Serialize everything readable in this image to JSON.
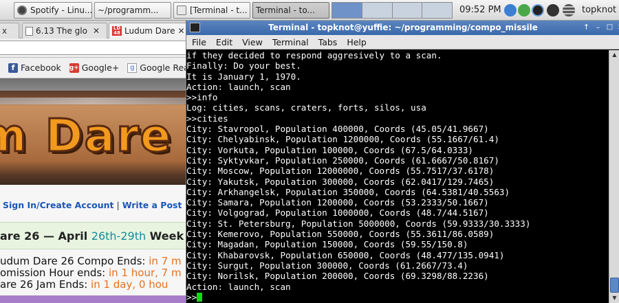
{
  "taskbar": {
    "tasks": [
      {
        "label": "Spotify - Linu...",
        "icon": "spotify-icon"
      },
      {
        "label": "~/programm...",
        "icon": "terminal-icon"
      },
      {
        "label": "[Terminal - t...",
        "icon": "terminal-icon"
      },
      {
        "label": "Terminal - to...",
        "icon": "terminal-icon"
      }
    ],
    "clock": "09:52 PM",
    "user": "topknot"
  },
  "browser": {
    "tabs": [
      {
        "label": "x"
      },
      {
        "label": "6.13 The glo"
      },
      {
        "label": "Ludum Dare"
      }
    ],
    "bookmarks": [
      "Facebook",
      "Google+",
      "Google Rea"
    ],
    "logo_text": "m Dare",
    "links": [
      "Sign In/Create Account",
      "Write a Post"
    ],
    "link_separator": "|",
    "heading": {
      "prefix": "are 26 — April ",
      "dates": "26th-29th",
      "suffix": " Week"
    },
    "deadlines": [
      {
        "label": "udum Dare 26 Compo Ends: ",
        "value": "in 7 m"
      },
      {
        "label": "omission Hour ends: ",
        "value": "in 1 hour, 7 m"
      },
      {
        "label": "are 26 Jam Ends: ",
        "value": "in 1 day, 0 hou"
      }
    ]
  },
  "terminal": {
    "title": "Terminal - topknot@yuffie: ~/programming/compo_missile",
    "menu": [
      "File",
      "Edit",
      "View",
      "Terminal",
      "Tabs",
      "Help"
    ],
    "lines": [
      "if they decided to respond aggresively to a scan.",
      "Finally: Do your best.",
      "It is January 1, 1970.",
      "Action: launch, scan",
      ">>info",
      "Log: cities, scans, craters, forts, silos, usa",
      ">>cities",
      "City: Stavropol, Population 400000, Coords (45.05/41.9667)",
      "City: Chelyabinsk, Population 1200000, Coords (55.1667/61.4)",
      "City: Vorkuta, Population 100000, Coords (67.5/64.0333)",
      "City: Syktyvkar, Population 250000, Coords (61.6667/50.8167)",
      "City: Moscow, Population 12000000, Coords (55.7517/37.6178)",
      "City: Yakutsk, Population 300000, Coords (62.0417/129.7465)",
      "City: Arkhangelsk, Population 350000, Coords (64.5381/40.5563)",
      "City: Samara, Population 1200000, Coords (53.2333/50.1667)",
      "City: Volgograd, Population 1000000, Coords (48.7/44.5167)",
      "City: St. Petersburg, Population 5000000, Coords (59.9333/30.3333)",
      "City: Kemerovo, Population 550000, Coords (55.3611/86.0589)",
      "City: Magadan, Population 150000, Coords (59.55/150.8)",
      "City: Khabarovsk, Population 650000, Coords (48.477/135.0941)",
      "City: Surgut, Population 300000, Coords (61.2667/73.4)",
      "City: Norilsk, Population 200000, Coords (69.3298/88.2236)",
      "Action: launch, scan"
    ],
    "prompt": ">>",
    "cursor_color": "#19d619"
  },
  "colors": {
    "titlebar": "#3a68aa",
    "link": "#1a56b8",
    "deadline_value": "#e8701a",
    "date_teal": "#1a8a9a"
  }
}
